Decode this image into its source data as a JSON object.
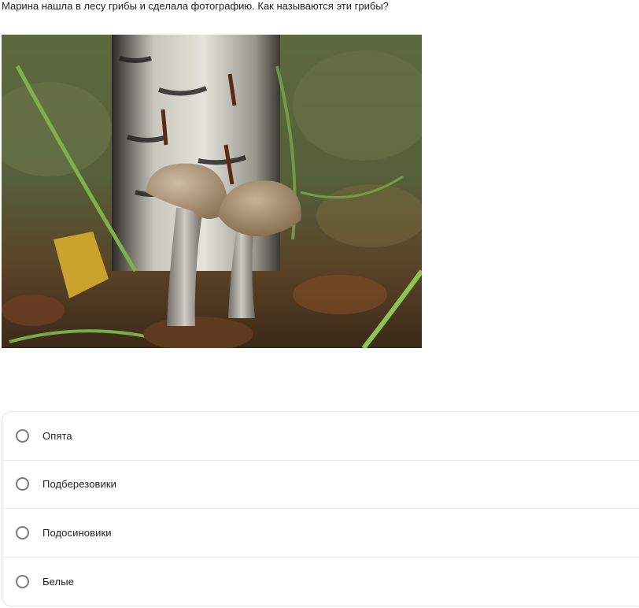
{
  "question": {
    "text": "Марина нашла в лесу грибы и сделала фотографию. Как называются эти грибы?"
  },
  "photo": {
    "subject": "mushrooms-photo"
  },
  "options": [
    {
      "label": "Опята",
      "selected": false
    },
    {
      "label": "Подберезовики",
      "selected": false
    },
    {
      "label": "Подосиновики",
      "selected": false
    },
    {
      "label": "Белые",
      "selected": false
    }
  ]
}
